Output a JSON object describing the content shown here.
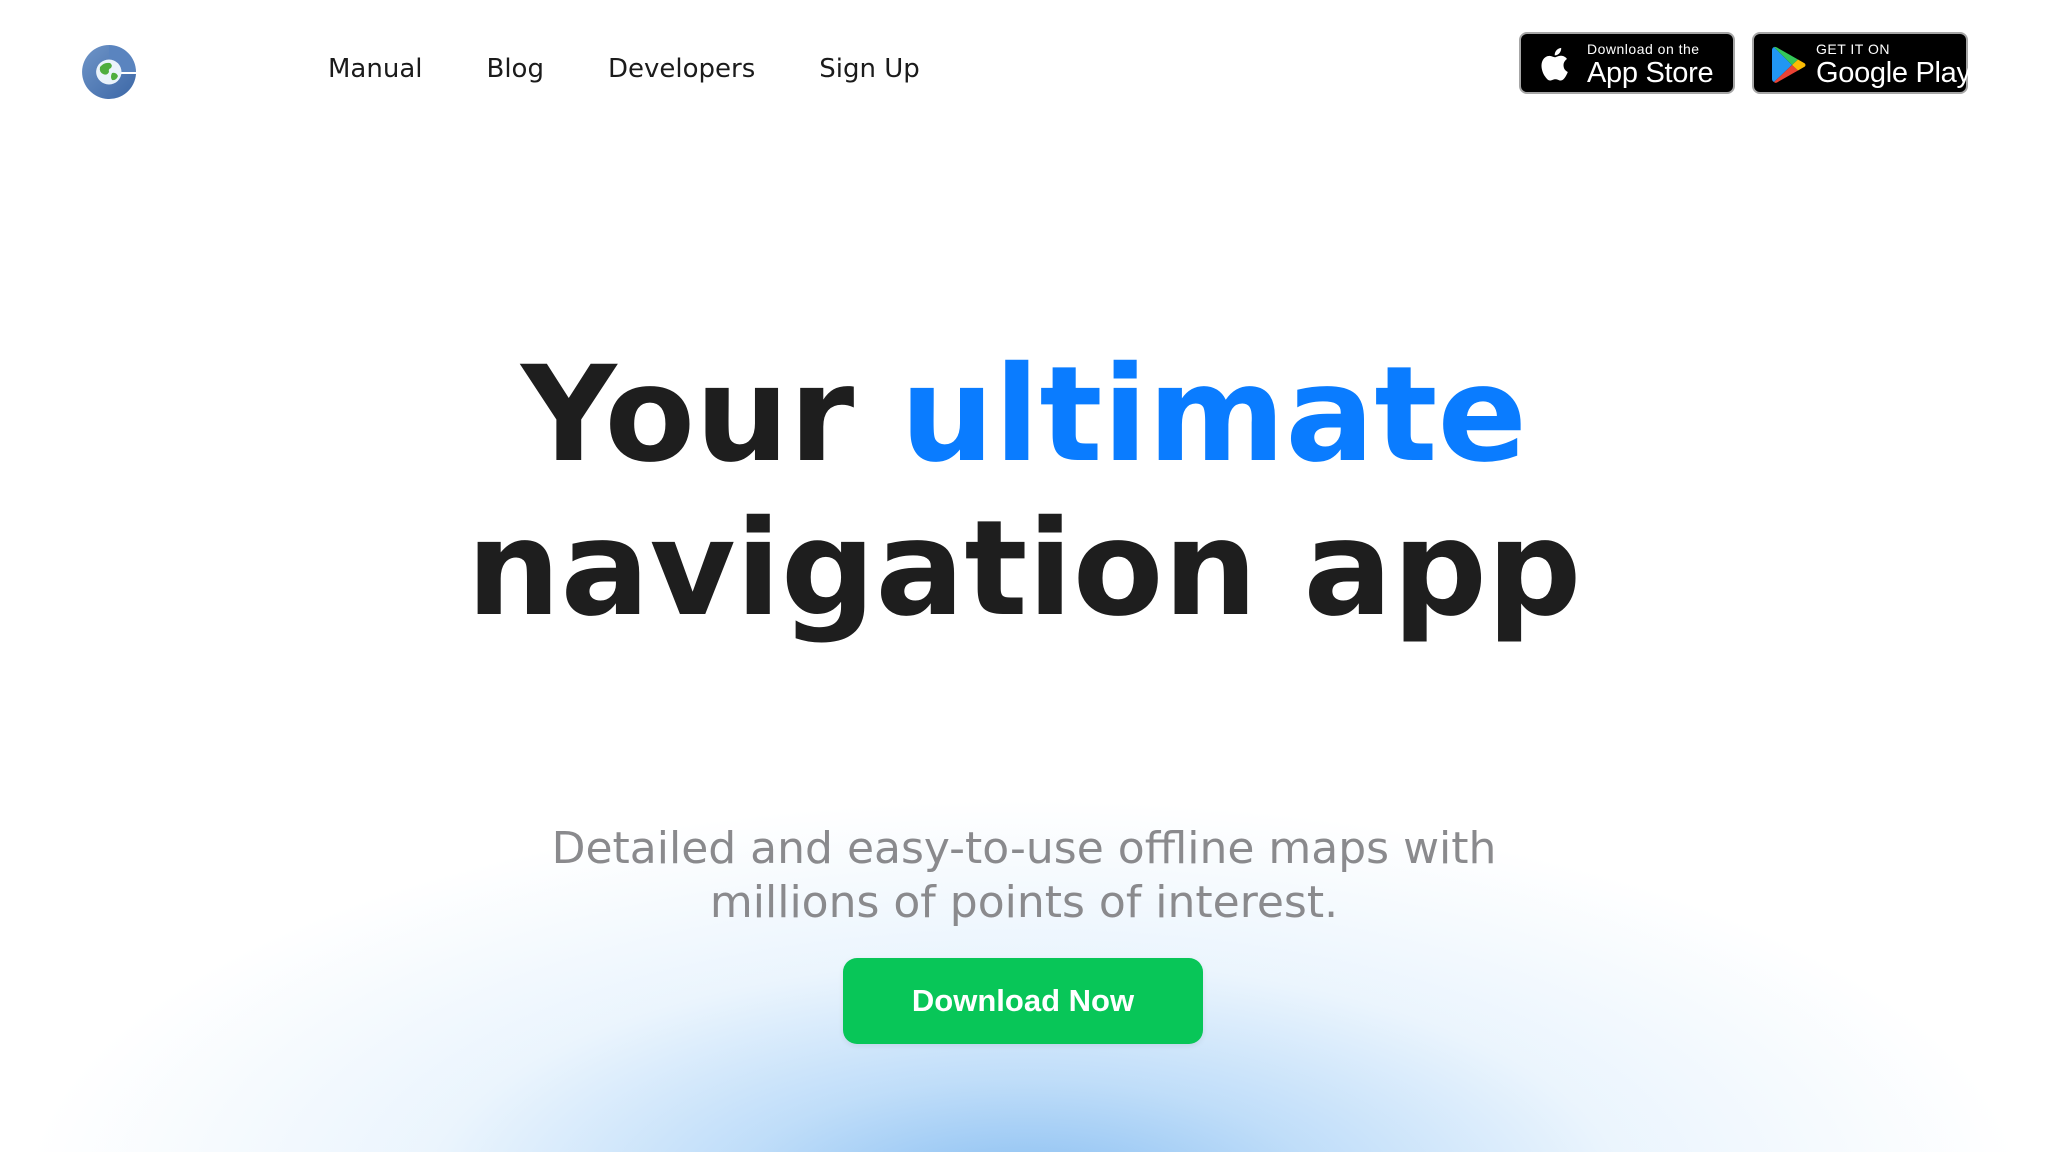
{
  "header": {
    "logo_icon": "globe-g-logo-icon",
    "nav": [
      {
        "label": "Manual"
      },
      {
        "label": "Blog"
      },
      {
        "label": "Developers"
      },
      {
        "label": "Sign Up"
      }
    ],
    "app_store": {
      "icon": "apple-icon",
      "small": "Download on the",
      "big": "App Store"
    },
    "google_play": {
      "icon": "google-play-icon",
      "small": "GET IT ON",
      "big": "Google Play"
    }
  },
  "hero": {
    "title_part1": "Your ",
    "title_accent": "ultimate",
    "title_part2": " navigation app",
    "subtitle": "Detailed and easy-to-use offline maps with millions of points of interest.",
    "cta_label": "Download Now"
  },
  "colors": {
    "accent": "#0a7cff",
    "cta": "#08c658",
    "title": "#1e1e1e",
    "subtitle": "#8a8a8d"
  }
}
